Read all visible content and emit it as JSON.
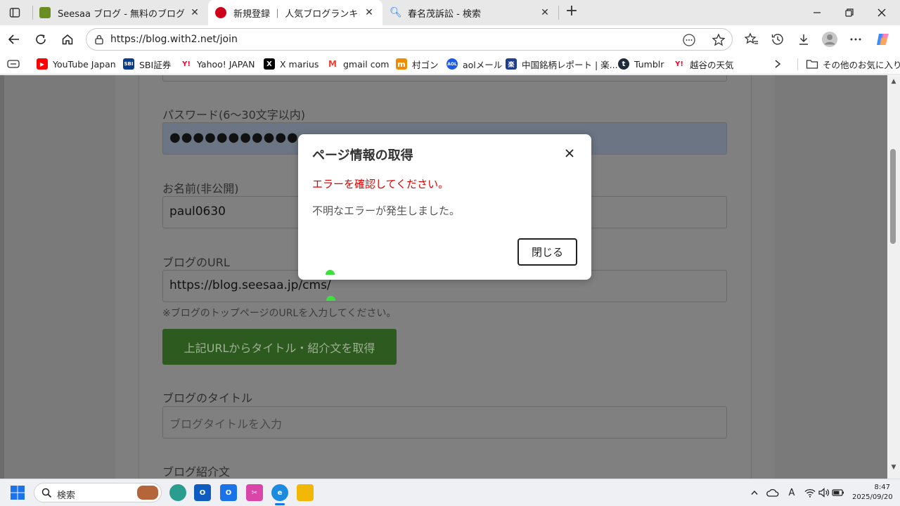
{
  "tabs": [
    {
      "title": "Seesaa ブログ - 無料のブログ(blog)サ",
      "color": "#6b8e23"
    },
    {
      "title": "新規登録 ｜ 人気ブログランキング",
      "color": "#d0021b"
    },
    {
      "title": "春名茂訴訟 - 検索",
      "color": "#1a73e8"
    }
  ],
  "address": {
    "url": "https://blog.with2.net/join"
  },
  "bookmarks": [
    {
      "label": "YouTube Japan",
      "icon": "youtube-icon",
      "color": "#ff0000",
      "glyph": "▶"
    },
    {
      "label": "SBI証券",
      "icon": "sbi-icon",
      "color": "#0a3c8c",
      "glyph": "SBI"
    },
    {
      "label": "Yahoo! JAPAN",
      "icon": "yahoo-icon",
      "color": "#ff0033",
      "glyph": "Y!"
    },
    {
      "label": "X marius",
      "icon": "x-icon",
      "color": "#000000",
      "glyph": "X"
    },
    {
      "label": "gmail com",
      "icon": "gmail-icon",
      "color": "#ea4335",
      "glyph": "M"
    },
    {
      "label": "村ゴン",
      "icon": "mura-icon",
      "color": "#f08c00",
      "glyph": "m"
    },
    {
      "label": "aolメール",
      "icon": "aol-icon",
      "color": "#1a5ae6",
      "glyph": "AOL"
    },
    {
      "label": "中国銘柄レポート | 楽...",
      "icon": "rakuten-icon",
      "color": "#1d3f8c",
      "glyph": "楽"
    },
    {
      "label": "Tumblr",
      "icon": "tumblr-icon",
      "color": "#1f2a3a",
      "glyph": "t"
    },
    {
      "label": "越谷の天気",
      "icon": "yahoo-weather-icon",
      "color": "#ff0033",
      "glyph": "Y!"
    }
  ],
  "bookmarks_other": "その他のお気に入り",
  "form": {
    "password_label": "パスワード(6〜30文字以内)",
    "password_value": "●●●●●●●●●●●",
    "name_label": "お名前(非公開)",
    "name_value": "paul0630",
    "url_label": "ブログのURL",
    "url_value": "https://blog.seesaa.jp/cms/",
    "url_hint": "※ブログのトップページのURLを入力してください。",
    "fetch_button": "上記URLからタイトル・紹介文を取得",
    "title_label": "ブログのタイトル",
    "title_placeholder": "ブログタイトルを入力",
    "intro_label": "ブログ紹介文"
  },
  "modal": {
    "title": "ページ情報の取得",
    "error_heading": "エラーを確認してください。",
    "message": "不明なエラーが発生しました。",
    "close_button": "閉じる"
  },
  "taskbar": {
    "search_text": "検索",
    "ime": "A",
    "time": "8:47",
    "date": "2025/09/20"
  }
}
